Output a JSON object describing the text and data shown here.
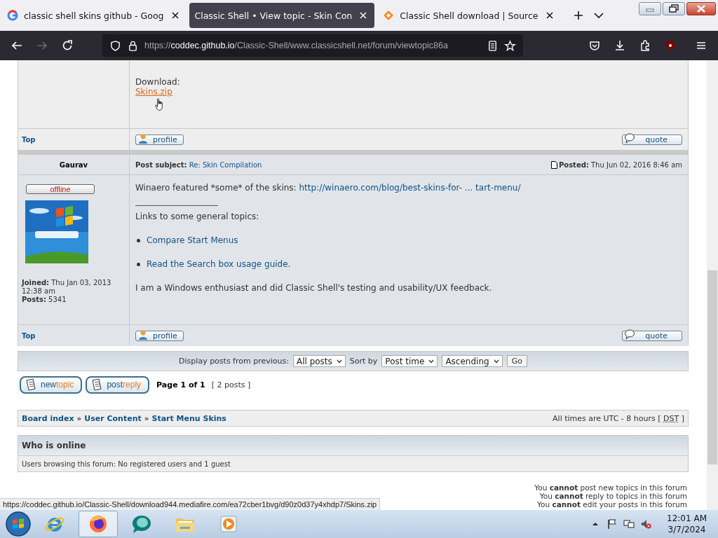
{
  "tabs": [
    {
      "kind": "google",
      "title": "classic shell skins github - Goog",
      "selected": false
    },
    {
      "kind": "none",
      "title": "Classic Shell • View topic - Skin Con",
      "selected": true
    },
    {
      "kind": "sourceforge",
      "title": "Classic Shell download | Source",
      "selected": false
    }
  ],
  "nav_buttons": [
    {
      "kind": "back",
      "disabled": false
    },
    {
      "kind": "forward",
      "disabled": true
    },
    {
      "kind": "reload",
      "disabled": false
    }
  ],
  "address": {
    "scheme": "https://",
    "host": "coddec.github.io",
    "path": "/Classic-Shell/www.classicshell.net/forum/viewtopic86a"
  },
  "first_post": {
    "body": [
      {
        "kind": "text",
        "text": "Download:"
      },
      {
        "kind": "link",
        "text": "Skins.zip",
        "hovered": true
      }
    ],
    "footer": {
      "top": "Top",
      "profile": "profile",
      "quote": "quote"
    }
  },
  "second_post": {
    "author": "Gaurav",
    "status": "offline",
    "joined_label": "Joined:",
    "joined": "Thu Jan 03, 2013 12:38 am",
    "posts_label": "Posts:",
    "posts": "5341",
    "subject_label": "Post subject:",
    "subject": "Re: Skin Compilation",
    "posted_label": "Posted:",
    "posted": "Thu Jun 02, 2016 8:46 am",
    "body": [
      {
        "kind": "text",
        "text": "Winaero featured *some* of the skins: ",
        "link": "http://winaero.com/blog/best-skins-for- ... tart-menu/"
      },
      {
        "kind": "rule"
      },
      {
        "kind": "text",
        "text": "Links to some general topics:"
      },
      {
        "kind": "bullet",
        "link": "Compare Start Menus"
      },
      {
        "kind": "bullet",
        "link": "Read the Search box usage guide",
        "after": "."
      },
      {
        "kind": "text",
        "text": "I am a Windows enthusiast and did Classic Shell's testing and usability/UX feedback."
      }
    ],
    "footer": {
      "top": "Top",
      "profile": "profile",
      "quote": "quote"
    }
  },
  "display_bar": {
    "label": "Display posts from previous:",
    "period": "All posts",
    "sort_label": "Sort by",
    "sort_key": "Post time",
    "order": "Ascending",
    "go": "Go"
  },
  "action_buttons": [
    {
      "first": "new",
      "second": "topic"
    },
    {
      "first": "post",
      "second": "reply"
    }
  ],
  "pagination": {
    "page": "Page 1 of 1",
    "count": "[ 2 posts ]"
  },
  "breadcrumbs": {
    "items": [
      "Board index",
      "User Content",
      "Start Menu Skins"
    ],
    "separator": "»",
    "timezone": "All times are UTC - 8 hours [",
    "dst": "DST",
    "close": "]"
  },
  "who_is_online": {
    "title": "Who is online",
    "text": "Users browsing this forum: No registered users and 1 guest"
  },
  "permissions": [
    "You **cannot** post new topics in this forum",
    "You **cannot** reply to topics in this forum",
    "You **cannot** edit your posts in this forum"
  ],
  "status_link": "https://coddec.github.io/Classic-Shell/download944.mediafire.com/ea72cber1bvg/d90z0d37y4xhdp7/Skins.zip",
  "taskbar": {
    "items": [
      {
        "kind": "ie",
        "selected": false
      },
      {
        "kind": "firefox",
        "selected": true
      },
      {
        "kind": "chat",
        "selected": false
      },
      {
        "kind": "folder",
        "selected": false
      },
      {
        "kind": "media",
        "selected": false
      }
    ],
    "time": "12:01 AM",
    "date": "3/7/2024"
  }
}
